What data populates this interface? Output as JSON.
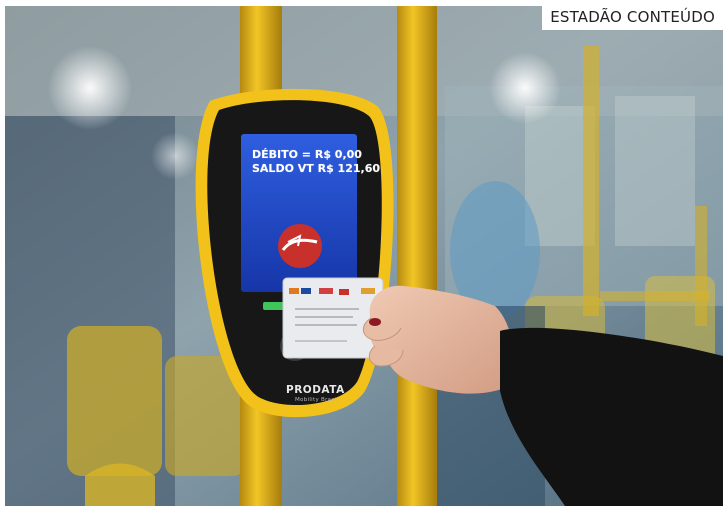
{
  "photo_credit": "ESTADÃO CONTEÚDO",
  "validator": {
    "screen_line_1": "DÉBITO = R$ 0,00",
    "screen_line_2": "SALDO VT R$ 121,60",
    "brand": "PRODATA",
    "brand_sub": "Mobility Brasil"
  },
  "colors": {
    "pole_yellow": "#e5b81c",
    "device_yellow": "#f2c21b",
    "screen_blue": "#1c47c9",
    "sleeve_black": "#121212"
  },
  "icons": [
    "validator-device",
    "transit-card",
    "hand",
    "bus-pole"
  ]
}
